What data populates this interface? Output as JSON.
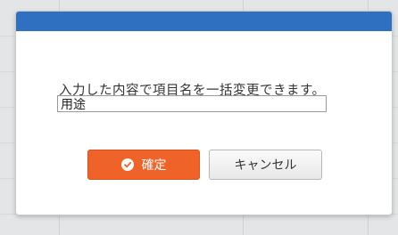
{
  "dialog": {
    "message": "入力した内容で項目名を一括変更できます。",
    "input": {
      "value": "用途"
    },
    "buttons": {
      "confirm": {
        "label": "確定",
        "icon": "check-circle-icon",
        "color": "#ef6328"
      },
      "cancel": {
        "label": "キャンセル"
      }
    },
    "header_color": "#2f70c1"
  }
}
